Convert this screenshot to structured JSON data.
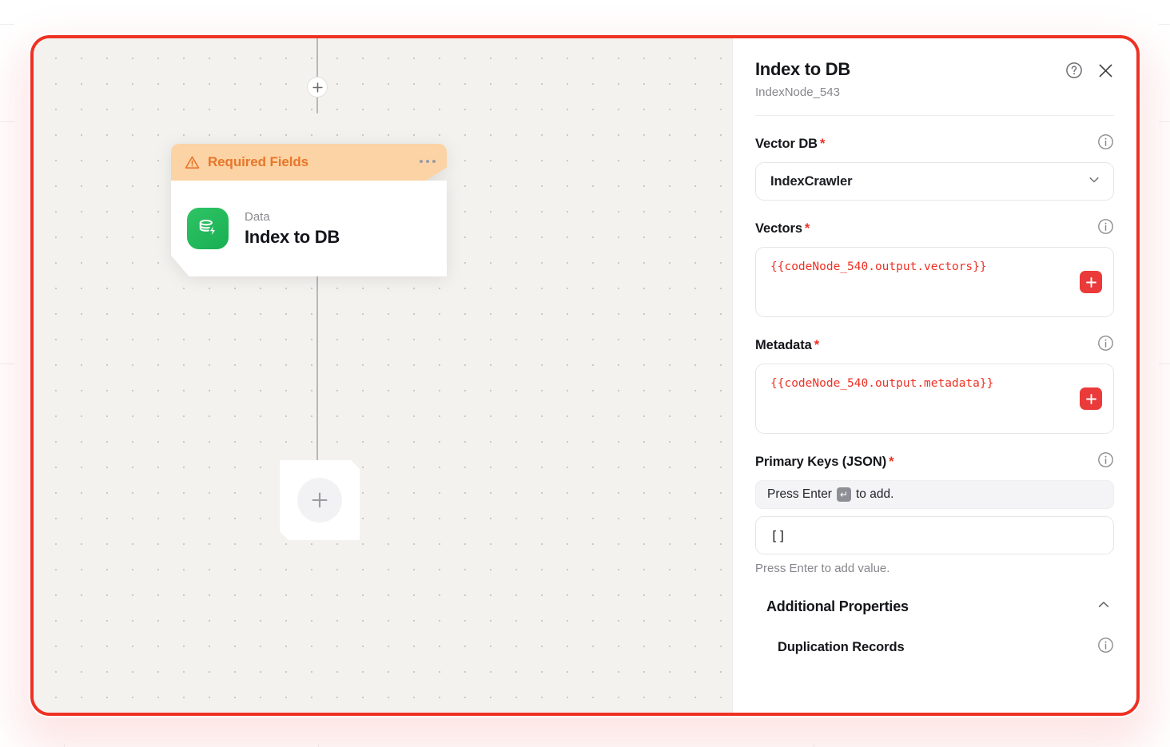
{
  "canvas": {
    "node": {
      "banner_label": "Required Fields",
      "warning_icon": "warning-triangle-icon",
      "menu_icon": "more-options-icon",
      "kicker": "Data",
      "title": "Index to DB",
      "icon": "database-lightning-icon"
    },
    "add_node_icon": "plus-icon",
    "edge_plus_icon": "plus-icon"
  },
  "panel": {
    "title": "Index to DB",
    "subtitle": "IndexNode_543",
    "help_icon": "help-circle-icon",
    "close_icon": "close-icon",
    "fields": {
      "vector_db": {
        "label": "Vector DB",
        "required": "*",
        "value": "IndexCrawler",
        "info_icon": "info-icon",
        "chevron_icon": "chevron-down-icon"
      },
      "vectors": {
        "label": "Vectors",
        "required": "*",
        "value": "{{codeNode_540.output.vectors}}",
        "info_icon": "info-icon",
        "add_icon": "plus-icon"
      },
      "metadata": {
        "label": "Metadata",
        "required": "*",
        "value": "{{codeNode_540.output.metadata}}",
        "info_icon": "info-icon",
        "add_icon": "plus-icon"
      },
      "primary_keys": {
        "label": "Primary Keys (JSON)",
        "required": "*",
        "hint_prefix": "Press Enter",
        "hint_key": "↵",
        "hint_suffix": "to add.",
        "value": "[]",
        "help": "Press Enter to add value.",
        "info_icon": "info-icon"
      }
    },
    "additional_properties": {
      "title": "Additional Properties",
      "chevron_icon": "chevron-up-icon",
      "items": [
        {
          "label": "Duplication Records",
          "info_icon": "info-icon"
        }
      ]
    }
  },
  "colors": {
    "highlight": "#ee3124",
    "accent_red": "#ea3a3a",
    "banner": "#fcd3a4",
    "banner_text": "#e8762a",
    "node_icon": "#18ae52",
    "canvas_bg": "#f3f2ef"
  }
}
